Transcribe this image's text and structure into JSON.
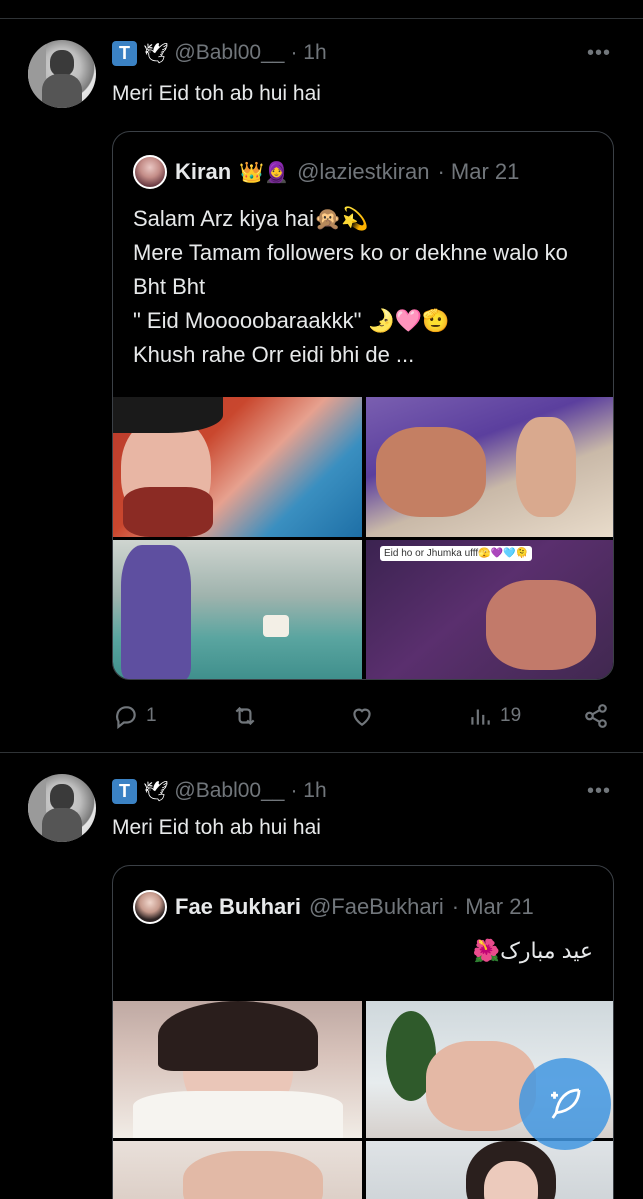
{
  "colors": {
    "background": "#000000",
    "text": "#e7e9ea",
    "muted": "#71767b",
    "accent": "#1d9bf0",
    "divider": "#2f3336"
  },
  "tweets": [
    {
      "handle": "@Babl00__",
      "time": "· 1h",
      "text": "Meri Eid toh ab hui hai",
      "more_icon": "more-horizontal-icon",
      "quote": {
        "name": "Kiran",
        "name_emoji": "👑🧕",
        "handle": "@laziestkiran",
        "date": "· Mar 21",
        "body": "Salam Arz kiya hai🙊💫\nMere Tamam followers ko or dekhne walo ko Bht Bht\n\" Eid Mooooobaraakkk\" 🌛🩷🫡\nKhush rahe  Orr eidi  bhi de ...",
        "image_overlay_text": "Eid ho or Jhumka ufff🫣💜🩵🫠"
      },
      "actions": {
        "replies": "1",
        "retweets": "",
        "likes": "",
        "views": "19"
      }
    },
    {
      "handle": "@Babl00__",
      "time": "· 1h",
      "text": "Meri Eid toh ab hui hai",
      "more_icon": "more-horizontal-icon",
      "quote": {
        "name": "Fae Bukhari",
        "handle": "@FaeBukhari",
        "date": "· Mar 21",
        "body": "عید مبارک🌺"
      }
    }
  ],
  "compose_fab": {
    "icon": "compose-feather-icon"
  }
}
